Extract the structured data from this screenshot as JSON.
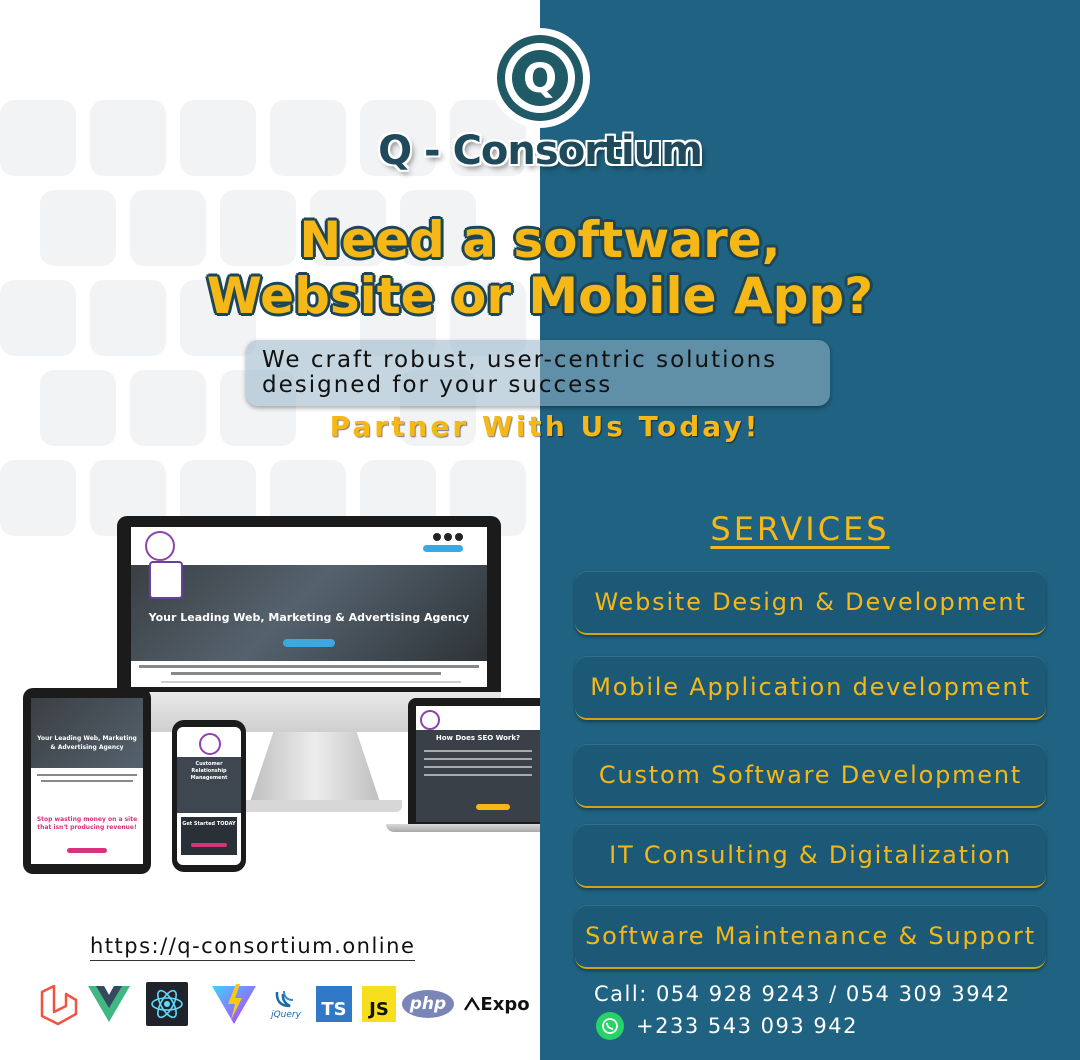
{
  "brand": {
    "logo_letter": "Q",
    "name": "Q - Consortium"
  },
  "headline": {
    "line1": "Need a software,",
    "line2": "Website or Mobile App?"
  },
  "tagline": {
    "line1": "We craft robust, user-centric solutions",
    "line2": "designed for your success"
  },
  "cta": "Partner With Us Today!",
  "services": {
    "title": "SERVICES",
    "items": [
      "Website Design & Development",
      "Mobile Application development",
      "Custom Software Development",
      "IT Consulting & Digitalization",
      "Software Maintenance & Support"
    ]
  },
  "contact": {
    "call": "Call: 054 928 9243 / 054 309 3942",
    "whatsapp": "+233 543 093 942"
  },
  "website_url": "https://q-consortium.online",
  "tech_stack": {
    "ts": "TS",
    "js": "JS",
    "php": "php",
    "jquery": "jQuery",
    "expo": "Expo"
  },
  "mockups": {
    "desktop_hero": "Your Leading Web, Marketing & Advertising Agency",
    "tablet_hero": "Your Leading Web, Marketing & Advertising Agency",
    "tablet_banner": "Stop wasting money on a site that isn't producing revenue!",
    "phone_title": "Customer Relationship Management",
    "phone_cta": "Get Started TODAY",
    "laptop_title": "How Does SEO Work?"
  },
  "colors": {
    "accent_yellow": "#f5b816",
    "panel_blue": "#1f6281",
    "dark_teal": "#1e4a5c"
  }
}
